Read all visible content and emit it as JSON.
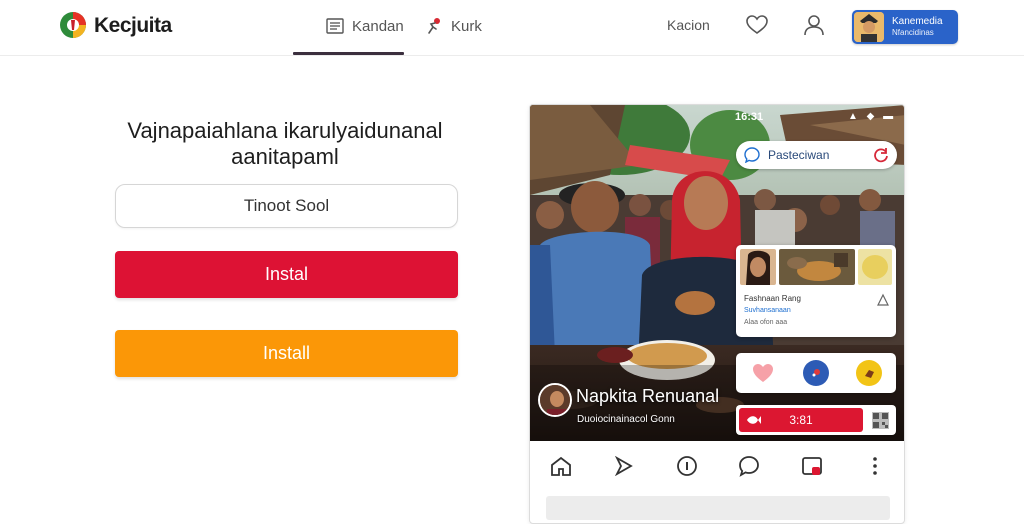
{
  "header": {
    "brand": "Kecjuita",
    "tabs": [
      {
        "label": "Kandan",
        "icon": "list-icon",
        "active": true
      },
      {
        "label": "Kurk",
        "icon": "person-run-icon",
        "active": false
      }
    ],
    "link": "Kacion",
    "account": {
      "line1": "Kanemedia",
      "line2": "Nfancidinas"
    }
  },
  "install": {
    "headline": "Vajnapaiahlana ikarulyaidunanal aanitapaml",
    "search_value": "Tinoot Sool",
    "primary_button": "Instal",
    "secondary_button": "Install"
  },
  "phone": {
    "status_time": "16:31",
    "status_icons": "▲ ◆ ▬",
    "search_label": "Pasteciwan",
    "post": {
      "author": "Fashnaan Rang",
      "sub": "Suvhansanaan",
      "sub2": "Alaa ofon aaa"
    },
    "cta_label": "3:81",
    "profile_name": "Napkita Renuanal",
    "profile_sub": "Duoiocinainacol Gonn"
  },
  "colors": {
    "accent_red": "#dd1234",
    "accent_orange": "#fb9707",
    "account_blue": "#2a63c9"
  }
}
